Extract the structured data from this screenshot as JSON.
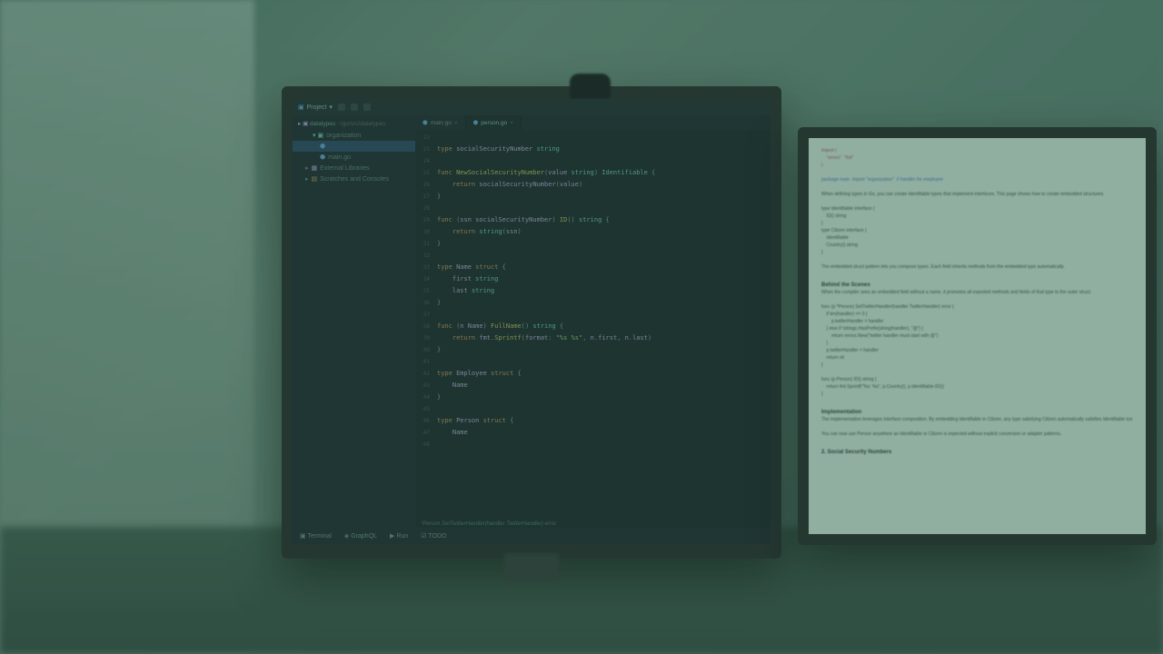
{
  "ide": {
    "toolbar": {
      "project_label": "Project"
    },
    "sidebar": {
      "root": "datatypes",
      "root_path": "~/go/src/datatypes",
      "items": [
        {
          "label": "organization",
          "level": 2
        },
        {
          "label": "",
          "level": 3,
          "selected": true
        },
        {
          "label": "main.go",
          "level": 3
        },
        {
          "label": "External Libraries",
          "level": 1
        },
        {
          "label": "Scratches and Consoles",
          "level": 1
        }
      ]
    },
    "tabs": [
      {
        "label": "main.go",
        "active": false
      },
      {
        "label": "person.go",
        "active": true
      }
    ],
    "gutter_start": 22,
    "gutter_end": 48,
    "code_lines": [
      "",
      "type socialSecurityNumber string",
      "",
      "func NewSocialSecurityNumber(value string) Identifiable {",
      "    return socialSecurityNumber(value)",
      "}",
      "",
      "func (ssn socialSecurityNumber) ID() string {",
      "    return string(ssn)",
      "}",
      "",
      "type Name struct {",
      "    first string",
      "    last string",
      "}",
      "",
      "func (n Name) FullName() string {",
      "    return fmt.Sprintf(format: \"%s %s\", n.first, n.last)",
      "}",
      "",
      "type Employee struct {",
      "    Name",
      "}",
      "",
      "type Person struct {",
      "    Name"
    ],
    "hint": "*Person.SetTwitterHandler(handler TwitterHandler) error",
    "statusbar": {
      "terminal": "Terminal",
      "graphql": "GraphQL",
      "run": "Run",
      "todo": "TODO"
    }
  }
}
